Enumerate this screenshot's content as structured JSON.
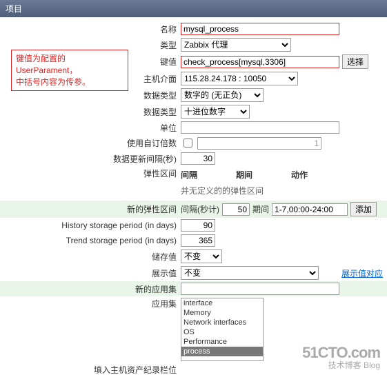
{
  "header": {
    "title": "项目"
  },
  "note": {
    "line1": "键值为配置的UserParament，",
    "line2": "中括号内容为传参。"
  },
  "fields": {
    "name": {
      "label": "名称",
      "value": "mysql_process"
    },
    "type": {
      "label": "类型",
      "value": "Zabbix 代理"
    },
    "key": {
      "label": "键值",
      "value": "check_process[mysql,3306]",
      "btn": "选择"
    },
    "host_if": {
      "label": "主机介面",
      "value": "115.28.24.178 : 10050"
    },
    "data_type1": {
      "label": "数据类型",
      "value": "数字的 (无正负)"
    },
    "data_type2": {
      "label": "数据类型",
      "value": "十进位数字"
    },
    "unit": {
      "label": "单位",
      "value": ""
    },
    "multiplier": {
      "label": "使用自订倍数",
      "checked": false,
      "value": "1"
    },
    "update": {
      "label": "数据更新间隔(秒)",
      "value": "30"
    },
    "flex": {
      "label": "弹性区间",
      "col1": "间隔",
      "col2": "期间",
      "col3": "动作",
      "desc": "并无定义的的弹性区间"
    },
    "new_flex": {
      "label": "新的弹性区间",
      "lbl1": "间隔(秒计)",
      "v1": "50",
      "lbl2": "期间",
      "v2": "1-7,00:00-24:00",
      "btn": "添加"
    },
    "history": {
      "label": "History storage period (in days)",
      "value": "90"
    },
    "trend": {
      "label": "Trend storage period (in days)",
      "value": "365"
    },
    "store": {
      "label": "储存值",
      "value": "不变"
    },
    "display": {
      "label": "展示值",
      "value": "不变",
      "link": "展示值对应"
    },
    "new_app": {
      "label": "新的应用集",
      "value": ""
    },
    "app": {
      "label": "应用集",
      "options": [
        "interface",
        "Memory",
        "Network interfaces",
        "OS",
        "Performance",
        "process"
      ],
      "selected": 5
    },
    "inventory": {
      "label": "填入主机资产纪录栏位"
    }
  },
  "watermark": {
    "big": "51CTO.com",
    "small": "技术博客    Blog"
  }
}
